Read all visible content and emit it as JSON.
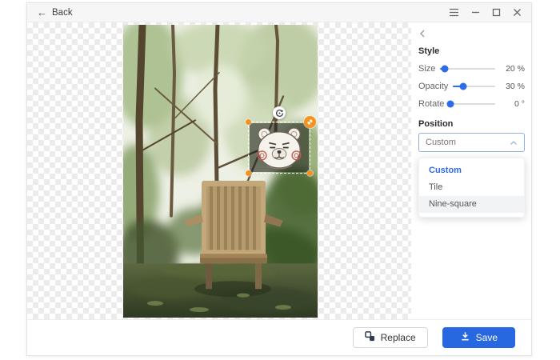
{
  "titlebar": {
    "back_arrow": "←",
    "back_label": "Back"
  },
  "canvas": {
    "watermark_sticker": "bear-face-sticker"
  },
  "sidebar": {
    "style_heading": "Style",
    "sliders": [
      {
        "label": "Size",
        "display": "20 %"
      },
      {
        "label": "Opacity",
        "display": "30 %"
      },
      {
        "label": "Rotate",
        "display": "0 °"
      }
    ],
    "position_heading": "Position",
    "position_select": {
      "value": "Custom"
    },
    "position_options": [
      {
        "label": "Custom",
        "state": "selected"
      },
      {
        "label": "Tile",
        "state": "normal"
      },
      {
        "label": "Nine-square",
        "state": "highlighted"
      }
    ]
  },
  "footer": {
    "replace_label": "Replace",
    "save_label": "Save"
  },
  "icons": {
    "back": "arrow-left",
    "menu": "hamburger",
    "minimize": "minus",
    "maximize": "square",
    "close": "x",
    "collapse": "chevron-left",
    "select_chevron": "chevron-up",
    "rotate_handle": "rotate-arrow",
    "resize_handle": "diagonal-arrow",
    "replace": "swap-squares",
    "save": "download-arrow"
  },
  "colors": {
    "accent_blue": "#2e6be6",
    "save_button": "#2767e0",
    "handle_orange": "#f5921e",
    "blush_red": "#c75a4d"
  }
}
